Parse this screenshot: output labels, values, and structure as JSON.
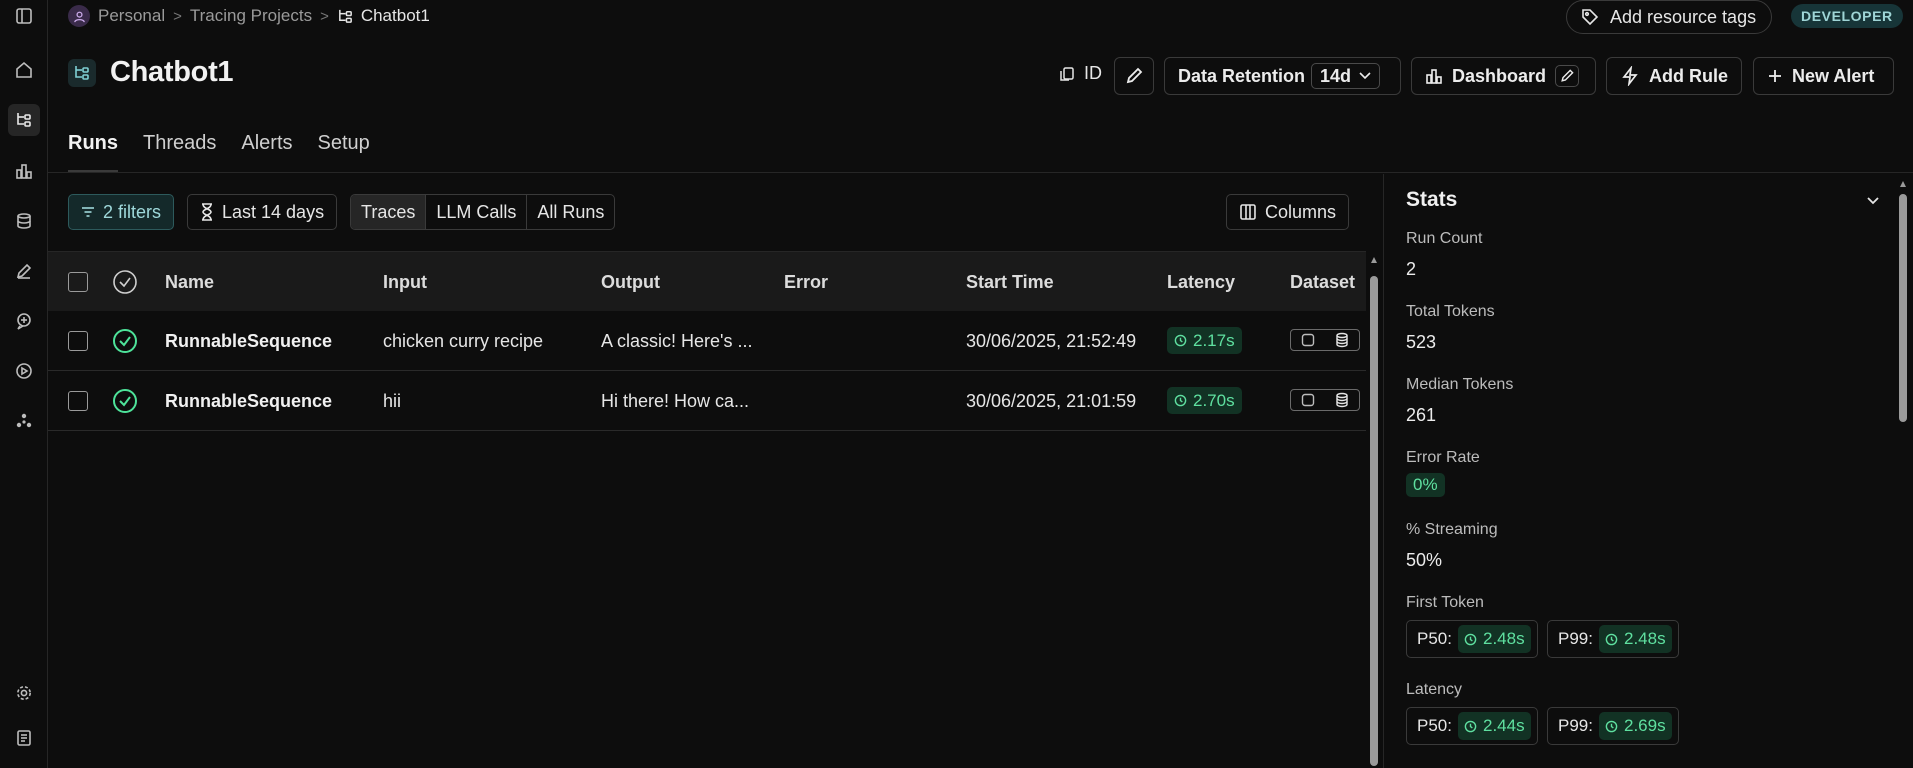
{
  "breadcrumb": {
    "root": "Personal",
    "section": "Tracing Projects",
    "current": "Chatbot1"
  },
  "header": {
    "tag_button": "Add resource tags",
    "env_badge": "DEVELOPER",
    "title": "Chatbot1",
    "id_label": "ID",
    "retention_label": "Data Retention",
    "retention_value": "14d",
    "dashboard_label": "Dashboard",
    "add_rule_label": "Add Rule",
    "new_alert_label": "New Alert"
  },
  "tabs": [
    "Runs",
    "Threads",
    "Alerts",
    "Setup"
  ],
  "toolbar": {
    "filters_label": "2 filters",
    "timerange_label": "Last 14 days",
    "segments": [
      "Traces",
      "LLM Calls",
      "All Runs"
    ],
    "columns_label": "Columns"
  },
  "table": {
    "headers": [
      "Name",
      "Input",
      "Output",
      "Error",
      "Start Time",
      "Latency",
      "Dataset"
    ],
    "rows": [
      {
        "name": "RunnableSequence",
        "input": "chicken curry recipe",
        "output": "A classic! Here's ...",
        "error": "",
        "start": "30/06/2025, 21:52:49",
        "latency": "2.17s"
      },
      {
        "name": "RunnableSequence",
        "input": "hii",
        "output": "Hi there! How ca...",
        "error": "",
        "start": "30/06/2025, 21:01:59",
        "latency": "2.70s"
      }
    ]
  },
  "stats": {
    "title": "Stats",
    "run_count_label": "Run Count",
    "run_count": "2",
    "total_tokens_label": "Total Tokens",
    "total_tokens": "523",
    "median_tokens_label": "Median Tokens",
    "median_tokens": "261",
    "error_rate_label": "Error Rate",
    "error_rate": "0%",
    "streaming_label": "% Streaming",
    "streaming": "50%",
    "first_token_label": "First Token",
    "first_token": {
      "p50_label": "P50:",
      "p50": "2.48s",
      "p99_label": "P99:",
      "p99": "2.48s"
    },
    "latency_label": "Latency",
    "latency": {
      "p50_label": "P50:",
      "p50": "2.44s",
      "p99_label": "P99:",
      "p99": "2.69s"
    }
  },
  "colors": {
    "accent_teal": "#9ed8da",
    "success_green": "#5fe0a0",
    "success_bg": "#123224",
    "badge_bg": "#173538"
  }
}
